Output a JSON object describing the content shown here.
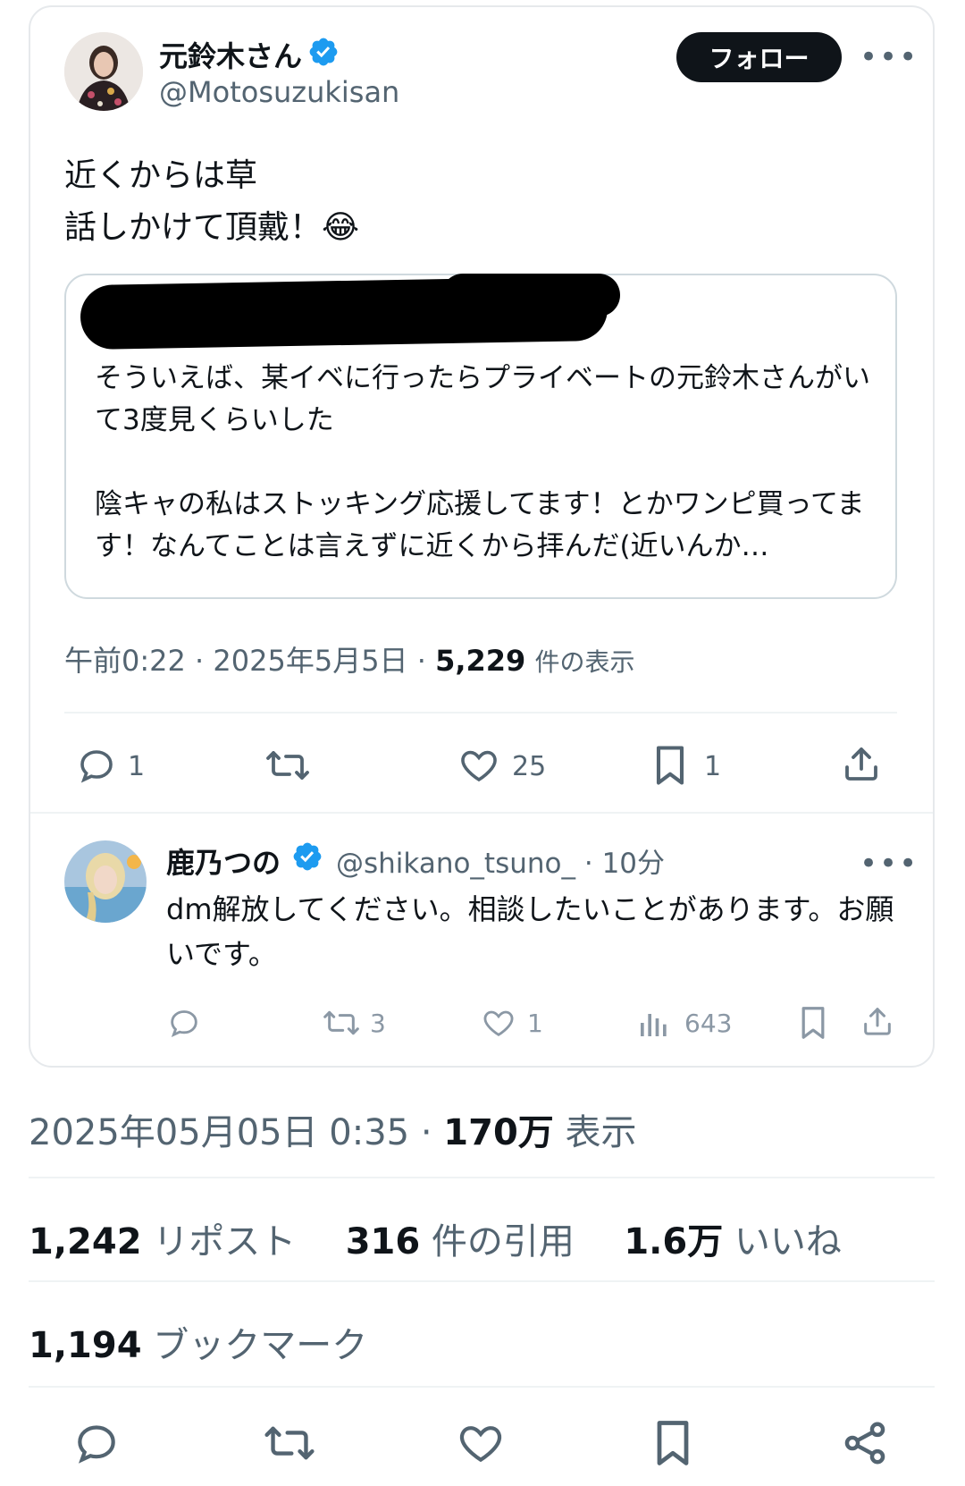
{
  "main_tweet": {
    "author_name": "元鈴木さん",
    "handle": "@Motosuzukisan",
    "follow_label": "フォロー",
    "more_label": "•••",
    "text_line1": "近くからは草",
    "text_line2": "話しかけて頂戴！😂",
    "quote": {
      "text": "そういえば、某イベに行ったらプライベートの元鈴木さんがいて3度見くらいした\n\n陰キャの私はストッキング応援してます！とかワンピ買ってます！なんてことは言えずに近くから拝んだ(近いんか…"
    },
    "time": "午前0:22",
    "date": "2025年5月5日",
    "views": "5,229",
    "views_label": "件の表示",
    "actions": {
      "reply": "1",
      "like": "25",
      "bookmark": "1"
    }
  },
  "reply_tweet": {
    "author_name": "鹿乃つの",
    "handle": "@shikano_tsuno_",
    "time": "· 10分",
    "more_label": "•••",
    "text": "dm解放してください。相談したいことがあります。お願いです。",
    "actions": {
      "retweet": "3",
      "like": "1",
      "views": "643"
    }
  },
  "post_meta": {
    "datetime": "2025年05月05日 0:35",
    "separator": "·",
    "views": "170万",
    "views_label": "表示"
  },
  "stats": {
    "reposts": "1,242",
    "reposts_label": "リポスト",
    "quotes": "316",
    "quotes_label": "件の引用",
    "likes": "1.6万",
    "likes_label": "いいね",
    "bookmarks": "1,194",
    "bookmarks_label": "ブックマーク"
  },
  "colors": {
    "verified": "#1d9bf0",
    "text": "#0f1419",
    "secondary": "#536471",
    "border": "#e6e9ec"
  }
}
